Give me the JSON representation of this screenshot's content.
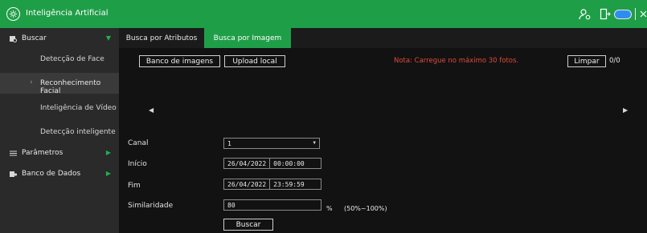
{
  "window": {
    "title": "Inteligência Artificial"
  },
  "sidebar": {
    "items": [
      {
        "label": "Buscar"
      },
      {
        "label": "Detecção de Face"
      },
      {
        "label": "Reconhecimento Facial"
      },
      {
        "label": "Inteligência de Vídeo"
      },
      {
        "label": "Detecção inteligente"
      },
      {
        "label": "Parâmetros"
      },
      {
        "label": "Banco de Dados"
      }
    ]
  },
  "tabs": [
    {
      "label": "Busca por Atributos"
    },
    {
      "label": "Busca por Imagem"
    }
  ],
  "toolbar": {
    "image_bank_label": "Banco de imagens",
    "upload_label": "Upload local",
    "note": "Nota: Carregue no máximo 30 fotos.",
    "clear_label": "Limpar",
    "count": "0/0"
  },
  "form": {
    "channel_label": "Canal",
    "channel_value": "1",
    "start_label": "Início",
    "start_date": "26/04/2022",
    "start_time": "00:00:00",
    "end_label": "Fim",
    "end_date": "26/04/2022",
    "end_time": "23:59:59",
    "similarity_label": "Similaridade",
    "similarity_value": "80",
    "percent_sign": "%",
    "similarity_range": "(50%~100%)",
    "search_label": "Buscar"
  },
  "colors": {
    "accent": "#1f9e48",
    "note": "#e04a3a",
    "sidebar_bg": "#2a2a2a",
    "content_bg": "#121212"
  },
  "icons": {
    "logo": "ai-brain-icon",
    "user": "user-settings-icon",
    "exit": "exit-icon",
    "cloud": "cloud-icon",
    "close": "close-icon"
  }
}
